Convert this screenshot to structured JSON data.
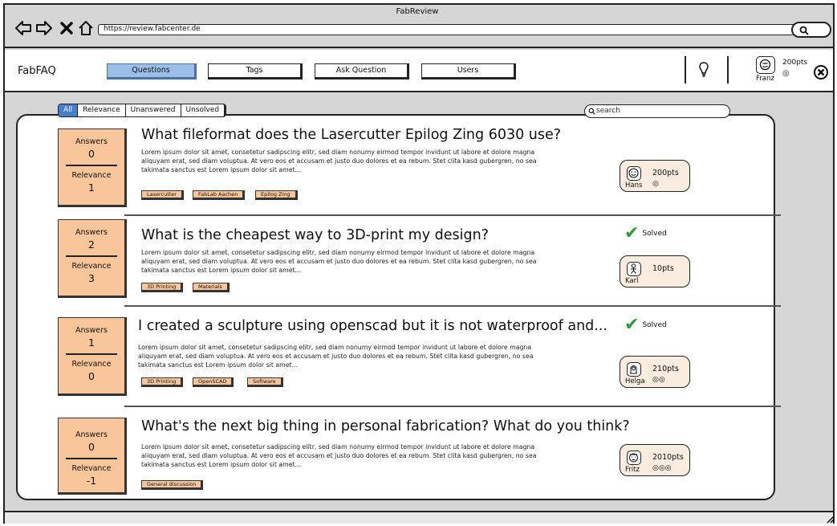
{
  "window": {
    "title": "FabReview",
    "url": "https://review.fabcenter.de"
  },
  "appbar": {
    "brand": "FabFAQ",
    "nav": [
      {
        "label": "Questions",
        "active": true
      },
      {
        "label": "Tags",
        "active": false
      },
      {
        "label": "Ask Question",
        "active": false
      },
      {
        "label": "Users",
        "active": false
      }
    ],
    "user": {
      "name": "Franz",
      "points": "200pts"
    }
  },
  "filters": [
    {
      "label": "All",
      "active": true
    },
    {
      "label": "Relevance",
      "active": false
    },
    {
      "label": "Unanswered",
      "active": false
    },
    {
      "label": "Unsolved",
      "active": false
    }
  ],
  "search": {
    "placeholder": "search"
  },
  "stat_labels": {
    "answers": "Answers",
    "relevance": "Relevance"
  },
  "questions": [
    {
      "title": "What fileformat does the Lasercutter Epilog Zing 6030 use?",
      "body": "Lorem ipsum dolor sit amet, consetetur sadipscing elitr, sed diam nonumy eirmod tempor invidunt ut labore et dolore magna aliquyam erat, sed diam voluptua. At vero eos et accusam et justo duo dolores et ea rebum. Stet clita kasd gubergren, no sea takimata sanctus est Lorem ipsum dolor sit amet...",
      "answers": "0",
      "relevance": "1",
      "tags": [
        "Lasercutter",
        "FabLab Aachen",
        "Epilog Zing"
      ],
      "solved": "",
      "user": {
        "name": "Hans",
        "points": "200pts",
        "badges": "◎"
      }
    },
    {
      "title": "What is the cheapest way to 3D-print my design?",
      "body": "Lorem ipsum dolor sit amet, consetetur sadipscing elitr, sed diam nonumy eirmod tempor invidunt ut labore et dolore magna aliquyam erat, sed diam voluptua. At vero eos et accusam et justo duo dolores et ea rebum. Stet clita kasd gubergren, no sea takimata sanctus est Lorem ipsum dolor sit amet...",
      "answers": "2",
      "relevance": "3",
      "tags": [
        "3D Printing",
        "Materials"
      ],
      "solved": "Solved",
      "user": {
        "name": "Karl",
        "points": "10pts",
        "badges": ""
      }
    },
    {
      "title": "I created a sculpture using openscad but it is not waterproof and...",
      "body": "Lorem ipsum dolor sit amet, consetetur sadipscing elitr, sed diam nonumy eirmod tempor invidunt ut labore et dolore magna aliquyam erat, sed diam voluptua. At vero eos et accusam et justo duo dolores et ea rebum. Stet clita kasd gubergren, no sea takimata sanctus est Lorem ipsum dolor sit amet...",
      "answers": "1",
      "relevance": "0",
      "tags": [
        "3D Printing",
        "OpenSCAD",
        "Software"
      ],
      "solved": "Solved",
      "user": {
        "name": "Helga",
        "points": "210pts",
        "badges": "◎◎"
      }
    },
    {
      "title": "What's the next big thing in personal fabrication? What do you think?",
      "body": "Lorem ipsum dolor sit amet, consetetur sadipscing elitr, sed diam nonumy eirmod tempor invidunt ut labore et dolore magna aliquyam erat, sed diam voluptua. At vero eos et accusam et justo duo dolores et ea rebum. Stet clita kasd gubergren, no sea takimata sanctus est Lorem ipsum dolor sit amet...",
      "answers": "0",
      "relevance": "-1",
      "tags": [
        "General discussion"
      ],
      "solved": "",
      "user": {
        "name": "Fritz",
        "points": "2010pts",
        "badges": "◎◎◎"
      }
    }
  ]
}
